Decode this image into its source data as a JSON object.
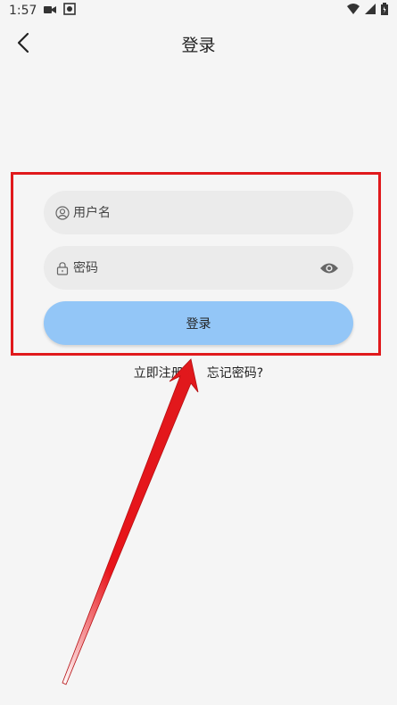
{
  "status_bar": {
    "time": "1:57"
  },
  "header": {
    "title": "登录"
  },
  "form": {
    "username_placeholder": "用户名",
    "password_placeholder": "密码",
    "login_label": "登录"
  },
  "links": {
    "register": "立即注册",
    "forgot": "忘记密码?"
  },
  "icons": {
    "back": "back-arrow-icon",
    "user": "user-icon",
    "lock": "lock-icon",
    "eye": "eye-icon"
  },
  "colors": {
    "background": "#f5f5f5",
    "field_bg": "#ebebeb",
    "login_button": "#93c6f7",
    "annotation": "#e0191c"
  }
}
